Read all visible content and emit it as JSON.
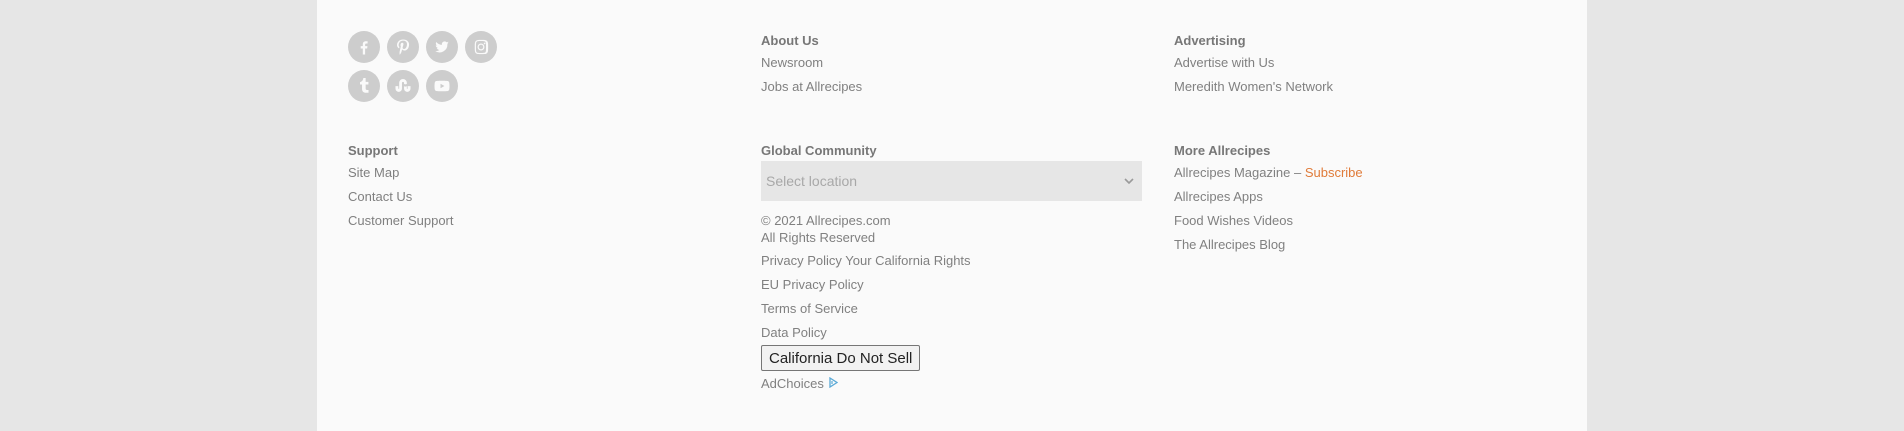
{
  "social": {
    "row1": [
      "facebook-icon",
      "pinterest-icon",
      "twitter-icon",
      "instagram-icon"
    ],
    "row2": [
      "tumblr-icon",
      "stumbleupon-icon",
      "youtube-icon"
    ]
  },
  "about": {
    "heading": "About Us",
    "links": [
      "Newsroom",
      "Jobs at Allrecipes"
    ]
  },
  "advertising": {
    "heading": "Advertising",
    "links": [
      "Advertise with Us",
      "Meredith Women's Network"
    ]
  },
  "support": {
    "heading": "Support",
    "links": [
      "Site Map",
      "Contact Us",
      "Customer Support"
    ]
  },
  "global": {
    "heading": "Global Community",
    "select_placeholder": "Select location",
    "copyright": "© 2021 Allrecipes.com",
    "rights": "All Rights Reserved",
    "links": [
      "Privacy Policy Your California Rights",
      "EU Privacy Policy",
      "Terms of Service",
      "Data Policy"
    ],
    "ccpa_button": "California Do Not Sell",
    "adchoices": "AdChoices"
  },
  "more": {
    "heading": "More Allrecipes",
    "magazine_label": "Allrecipes Magazine –",
    "subscribe_label": "Subscribe",
    "links": [
      "Allrecipes Apps",
      "Food Wishes Videos",
      "The Allrecipes Blog"
    ]
  },
  "colors": {
    "page_bg": "#e6e6e6",
    "footer_bg": "#fafafa",
    "icon_bg": "#cdcdcd",
    "accent": "#e07b39",
    "text": "#808080"
  }
}
